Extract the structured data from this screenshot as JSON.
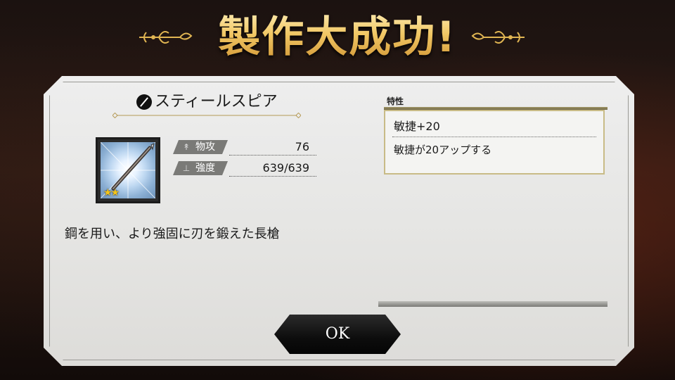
{
  "banner": {
    "title": "製作大成功!"
  },
  "item": {
    "name": "スティールスピア",
    "rarity_stars": "★★",
    "description": "鋼を用い、より強固に刃を鍛えた長槍"
  },
  "stats": [
    {
      "label": "物攻",
      "value": "76"
    },
    {
      "label": "強度",
      "value": "639/639"
    }
  ],
  "trait": {
    "header": "特性",
    "name": "敏捷+20",
    "description": "敏捷が20アップする"
  },
  "buttons": {
    "ok_label": "OK"
  },
  "colors": {
    "title_gold": "#f1c764",
    "trait_border": "#c8bb86",
    "star": "#f5c518"
  },
  "icons": {
    "weapon_type": "spear-icon",
    "stat1": "sword-icon",
    "stat2": "anvil-icon"
  }
}
